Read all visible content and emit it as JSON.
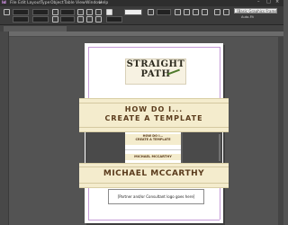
{
  "menubar": {
    "items": [
      "Id",
      "File",
      "Edit",
      "Layout",
      "Type",
      "Object",
      "Table",
      "View",
      "Window",
      "Help"
    ],
    "window_controls": [
      "–",
      "□",
      "×"
    ]
  },
  "toolbar": {
    "paragraph_style": "[Basic Graphics Frame]+",
    "autofit_label": "Auto-Fit"
  },
  "document": {
    "logo_line1": "STRAIGHT",
    "logo_line2": "PATH",
    "title_line1": "HOW DO I...",
    "title_line2": "CREATE A TEMPLATE",
    "author": "MICHAEL MCCARTHY",
    "partners_text": "[Partner and/or Consultant logo goes here]"
  },
  "video_preview": {
    "title_line1": "HOW DO I...",
    "title_line2": "CREATE A TEMPLATE",
    "author": "MICHAEL MCCARTHY"
  },
  "colors": {
    "band": "#f4eccd",
    "title_text": "#5a3b1c",
    "pasteboard": "#535353",
    "margin_guide": "#c59ad6"
  }
}
